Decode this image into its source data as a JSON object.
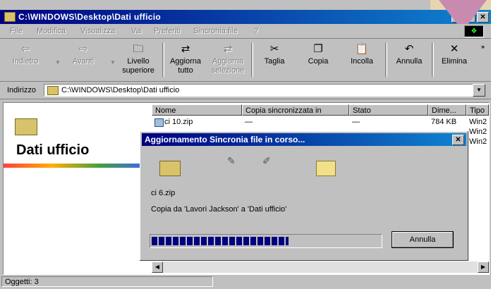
{
  "window": {
    "title": "C:\\WINDOWS\\Desktop\\Dati ufficio"
  },
  "title_buttons": {
    "minimize": "_",
    "maximize": "□",
    "close": "✕"
  },
  "menu": [
    "File",
    "Modifica",
    "Visualizza",
    "Vai",
    "Preferiti",
    "Sincronia file",
    "?"
  ],
  "toolbar": {
    "back": "Indietro",
    "forward": "Avanti",
    "up_line1": "Livello",
    "up_line2": "superiore",
    "update_all_line1": "Aggiorna",
    "update_all_line2": "tutto",
    "update_sel_line1": "Aggiorna",
    "update_sel_line2": "selezione",
    "cut": "Taglia",
    "copy": "Copia",
    "paste": "Incolla",
    "undo": "Annulla",
    "delete": "Elimina"
  },
  "address": {
    "label": "Indirizzo",
    "value": "C:\\WINDOWS\\Desktop\\Dati ufficio"
  },
  "folder": {
    "title": "Dati ufficio"
  },
  "list": {
    "columns": [
      "Nome",
      "Copia sincronizzata in",
      "Stato",
      "Dime...",
      "Tipo"
    ],
    "rows": [
      {
        "name": "ci 10.zip",
        "sync": "—",
        "status": "—",
        "size": "784 KB",
        "type": "Win2"
      },
      {
        "name": "",
        "sync": "",
        "status": "",
        "size": "",
        "type": "Win2"
      },
      {
        "name": "",
        "sync": "",
        "status": "",
        "size": "",
        "type": "Win2"
      }
    ]
  },
  "status": {
    "objects": "Oggetti: 3"
  },
  "dialog": {
    "title": "Aggiornamento Sincronia file in corso...",
    "file": "ci 6.zip",
    "message": "Copia da 'Lavori Jackson' a 'Dati ufficio'",
    "progress": 0.6,
    "cancel": "Annulla"
  },
  "icons": {
    "back": "arrow-left-icon",
    "forward": "arrow-right-icon",
    "cut": "scissors-icon",
    "copy": "copy-icon",
    "paste": "paste-icon",
    "undo": "undo-icon",
    "delete": "delete-x-icon"
  },
  "colors": {
    "title_start": "#000080",
    "title_end": "#1084d0",
    "progress": "#000080"
  }
}
